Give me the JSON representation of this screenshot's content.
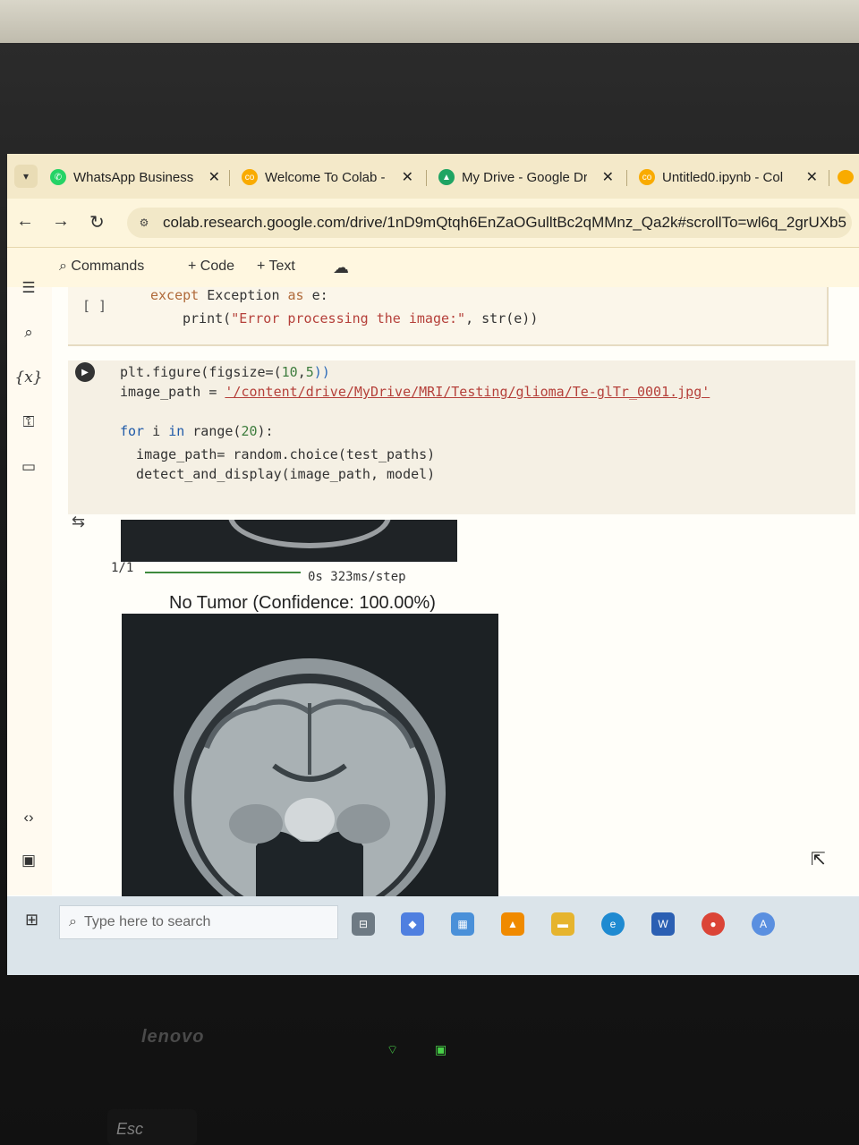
{
  "browser": {
    "tabs": [
      {
        "label": "WhatsApp Business",
        "icon": "whatsapp-icon",
        "color": "#25d366"
      },
      {
        "label": "Welcome To Colab - C",
        "icon": "colab-icon",
        "color": "#f9ab00"
      },
      {
        "label": "My Drive - Google Dr",
        "icon": "google-drive-icon",
        "color": "#1fa463"
      },
      {
        "label": "Untitled0.ipynb - Col",
        "icon": "colab-icon",
        "color": "#f9ab00"
      }
    ],
    "url": "colab.research.google.com/drive/1nD9mQtqh6EnZaOGulltBc2qMMnz_Qa2k#scrollTo=wl6q_2grUXb5"
  },
  "toolbar": {
    "commands_label": "Commands",
    "code_label": "+ Code",
    "text_label": "+ Text"
  },
  "cells": {
    "cell1": {
      "bracket": "[ ]",
      "line1_kw": "except",
      "line1_rest": " Exception ",
      "line1_as": "as",
      "line1_end": " e:",
      "line2_fn": "print(",
      "line2_str": "\"Error processing the image:\"",
      "line2_end": ", str(e))"
    },
    "cell2": {
      "line1_a": "plt.figure(figsize=(",
      "line1_num": "10",
      "line1_b": ",",
      "line1_num2": "5",
      "line1_c": "))",
      "line2_a": "image_path = ",
      "line2_str": "'/content/drive/MyDrive/MRI/Testing/glioma/Te-glTr_0001.jpg'",
      "line3_for": "for",
      "line3_mid": " i ",
      "line3_in": "in",
      "line3_range": " range(",
      "line3_num": "20",
      "line3_end": "):",
      "line4": "  image_path= random.choice(test_paths)",
      "line5": "  detect_and_display(image_path, model)"
    }
  },
  "output": {
    "progress_count": "1/1",
    "progress_time": "0s 323ms/step",
    "prediction": "No Tumor (Confidence: 100.00%)"
  },
  "taskbar": {
    "search_placeholder": "Type here to search"
  },
  "laptop": {
    "brand": "lenovo",
    "esc_key": "Esc"
  }
}
